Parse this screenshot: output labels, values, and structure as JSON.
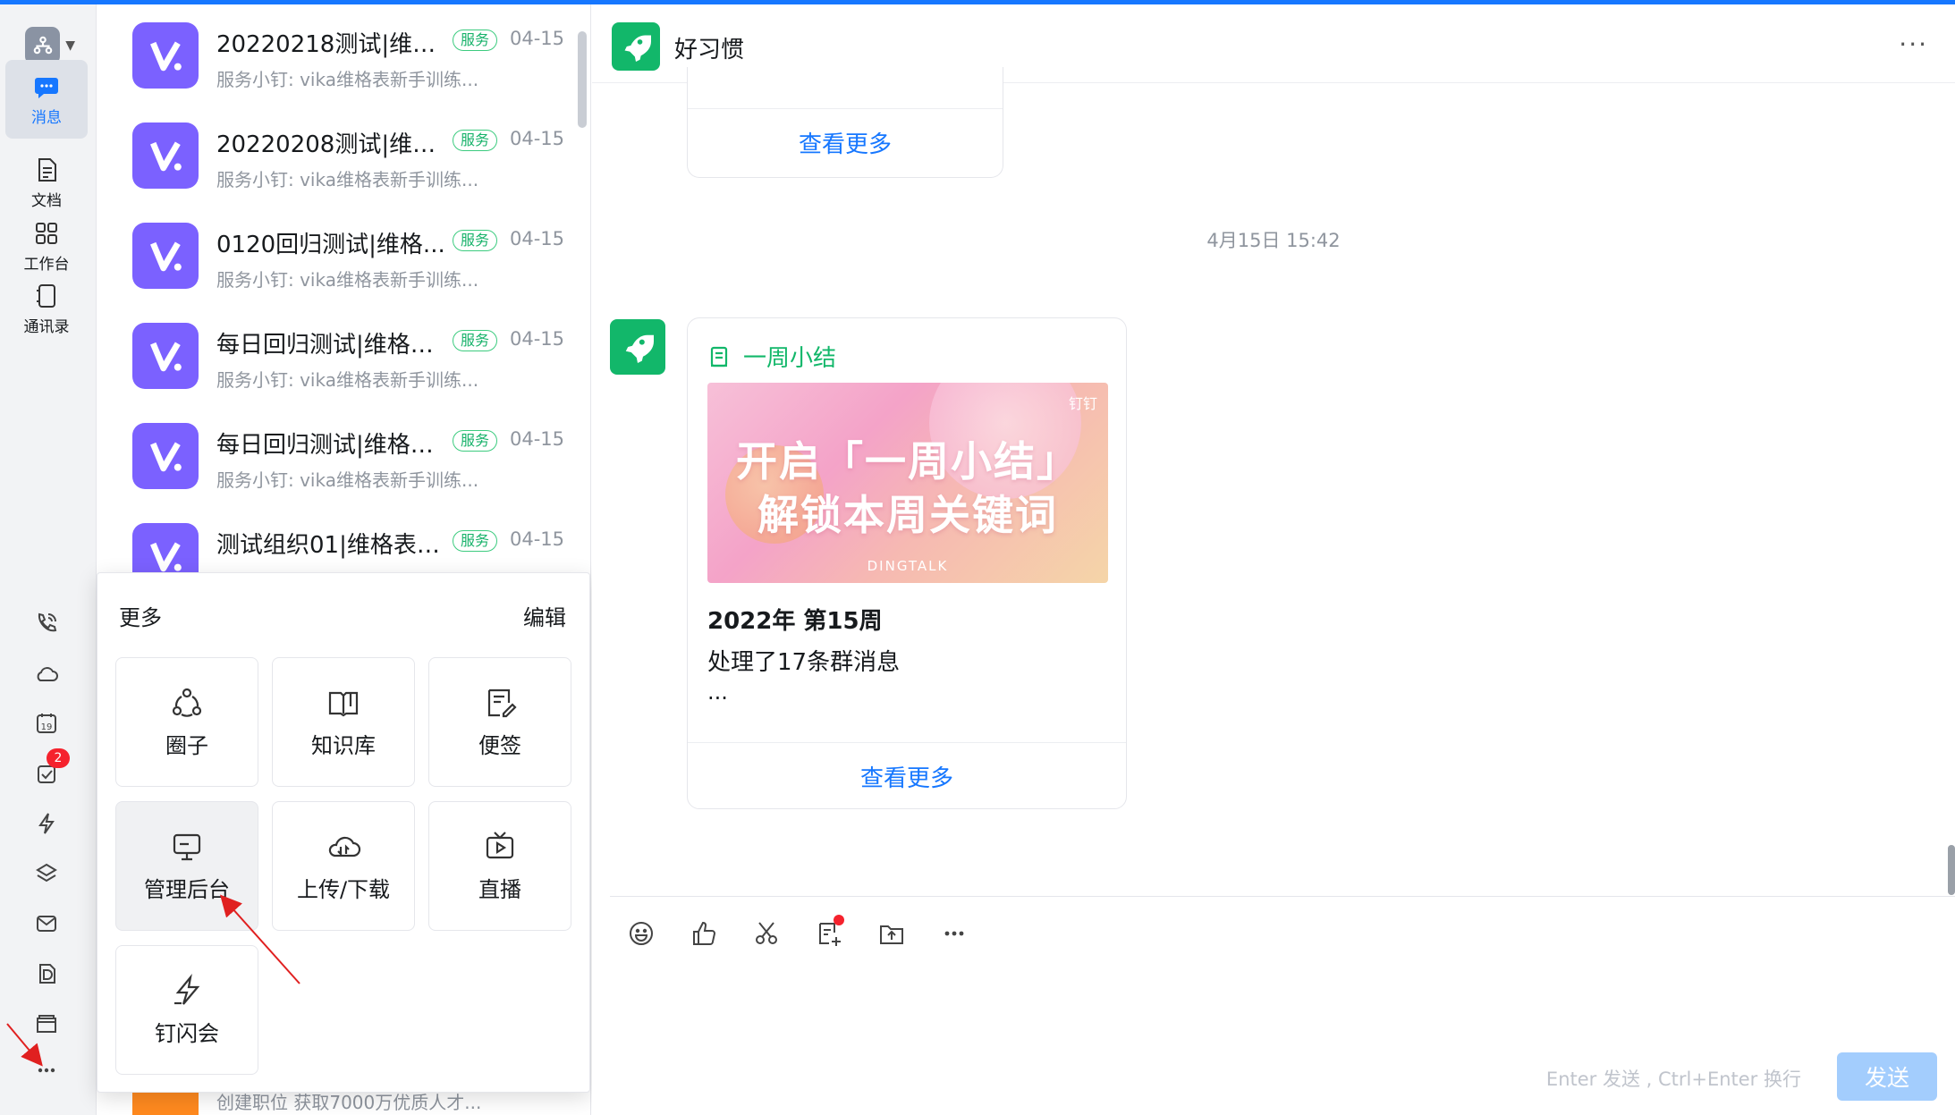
{
  "rail": {
    "items": [
      {
        "label": "消息",
        "icon": "chat-icon"
      },
      {
        "label": "文档",
        "icon": "document-icon"
      },
      {
        "label": "工作台",
        "icon": "workbench-icon"
      },
      {
        "label": "通讯录",
        "icon": "contacts-icon"
      }
    ],
    "todo_badge": "2",
    "calendar_day": "19"
  },
  "conversations": [
    {
      "title": "20220218测试|维格...",
      "tag": "服务",
      "date": "04-15",
      "preview": "服务小钉: vika维格表新手训练..."
    },
    {
      "title": "20220208测试|维格...",
      "tag": "服务",
      "date": "04-15",
      "preview": "服务小钉: vika维格表新手训练..."
    },
    {
      "title": "0120回归测试|维格...",
      "tag": "服务",
      "date": "04-15",
      "preview": "服务小钉: vika维格表新手训练..."
    },
    {
      "title": "每日回归测试|维格表...",
      "tag": "服务",
      "date": "04-15",
      "preview": "服务小钉: vika维格表新手训练..."
    },
    {
      "title": "每日回归测试|维格表...",
      "tag": "服务",
      "date": "04-15",
      "preview": "服务小钉: vika维格表新手训练..."
    },
    {
      "title": "测试组织01|维格表服...",
      "tag": "服务",
      "date": "04-15",
      "preview": ""
    }
  ],
  "conv_bottom_preview": "创建职位 获取7000万优质人才...",
  "more_popup": {
    "title": "更多",
    "edit": "编辑",
    "tiles": [
      {
        "label": "圈子",
        "icon": "circle-group-icon"
      },
      {
        "label": "知识库",
        "icon": "book-icon"
      },
      {
        "label": "便签",
        "icon": "note-icon"
      },
      {
        "label": "管理后台",
        "icon": "monitor-icon"
      },
      {
        "label": "上传/下载",
        "icon": "cloud-transfer-icon"
      },
      {
        "label": "直播",
        "icon": "live-tv-icon"
      },
      {
        "label": "钉闪会",
        "icon": "flash-meeting-icon"
      }
    ]
  },
  "chat": {
    "title": "好习惯",
    "view_more": "查看更多",
    "timestamp": "4月15日 15:42",
    "card": {
      "header": "一周小结",
      "banner_line1": "开启「一周小结」",
      "banner_line2": "解锁本周关键词",
      "banner_brand": "钉钉",
      "banner_footer": "DINGTALK",
      "week": "2022年 第15周",
      "summary": "处理了17条群消息",
      "ellipsis": "..."
    }
  },
  "composer": {
    "hint": "Enter 发送 , Ctrl+Enter 换行",
    "send": "发送",
    "tools": [
      "emoji-icon",
      "thumbs-up-icon",
      "scissors-icon",
      "note-add-icon",
      "upload-file-icon",
      "more-icon"
    ]
  },
  "colors": {
    "accent": "#1677ff",
    "green": "#12b76a",
    "vika": "#7b61ff",
    "badge": "#f5222d"
  }
}
